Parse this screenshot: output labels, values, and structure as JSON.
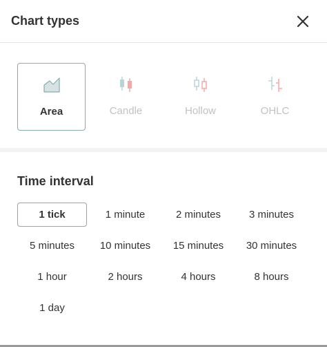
{
  "header": {
    "title": "Chart types"
  },
  "chart_types": [
    {
      "label": "Area",
      "icon": "area-chart-icon",
      "state": "active"
    },
    {
      "label": "Candle",
      "icon": "candle-chart-icon",
      "state": "disabled"
    },
    {
      "label": "Hollow",
      "icon": "hollow-candle-icon",
      "state": "disabled"
    },
    {
      "label": "OHLC",
      "icon": "ohlc-chart-icon",
      "state": "disabled"
    }
  ],
  "time_interval": {
    "title": "Time interval",
    "options": [
      {
        "label": "1 tick",
        "selected": true
      },
      {
        "label": "1 minute"
      },
      {
        "label": "2 minutes"
      },
      {
        "label": "3 minutes"
      },
      {
        "label": "5 minutes"
      },
      {
        "label": "10 minutes"
      },
      {
        "label": "15 minutes"
      },
      {
        "label": "30 minutes"
      },
      {
        "label": "1 hour"
      },
      {
        "label": "2 hours"
      },
      {
        "label": "4 hours"
      },
      {
        "label": "8 hours"
      },
      {
        "label": "1 day"
      }
    ]
  },
  "colors": {
    "accent_border": "#85acb0",
    "text": "#333333",
    "disabled_text": "#c2c2c2",
    "candle_red": "#f4a9a9",
    "candle_teal": "#b7d4d6",
    "area_fill": "#d9e2e3"
  }
}
